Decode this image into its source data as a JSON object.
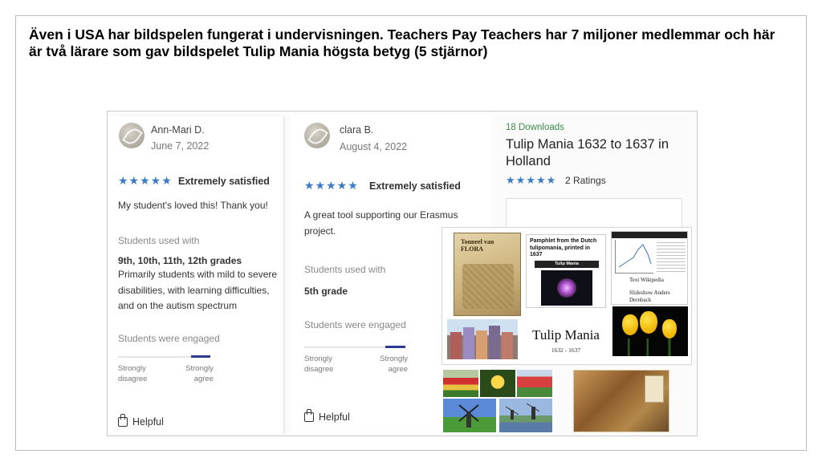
{
  "headline": "Även i USA har bildspelen fungerat i undervisningen. Teachers Pay Teachers har 7 miljoner medlemmar och här är två lärare som gav bildspelet Tulip Mania högsta betyg (5 stjärnor)",
  "colors": {
    "accent_blue": "#3a7bc8",
    "downloads_green": "#3a8a4a",
    "scale_navy": "#2b3a8f"
  },
  "reviews": [
    {
      "name": "Ann-Mari D.",
      "date": "June 7, 2022",
      "stars": "★★★★★",
      "rating_label": "Extremely satisfied",
      "text": "My student's loved this! Thank you!",
      "used_with_label": "Students used with",
      "grades": "9th, 10th, 11th, 12th grades",
      "details": "Primarily students with mild to severe disabilities, with learning difficulties, and on the autism spectrum",
      "engaged_label": "Students were engaged",
      "scale_left": "Strongly disagree",
      "scale_right": "Strongly agree",
      "engagement_level": 1.0,
      "helpful": "Helpful"
    },
    {
      "name": "clara B.",
      "date": "August 4, 2022",
      "stars": "★★★★★",
      "rating_label": "Extremely satisfied",
      "text": "A great tool supporting our Erasmus project.",
      "used_with_label": "Students used with",
      "grades": "5th grade",
      "engaged_label": "Students were engaged",
      "scale_left": "Strongly disagree",
      "scale_right": "Strongly agree",
      "engagement_level": 1.0,
      "helpful": "Helpful"
    }
  ],
  "product": {
    "downloads": "18 Downloads",
    "title": "Tulip Mania 1632 to 1637 in Holland",
    "stars": "★★★★★",
    "ratings": "2 Ratings"
  },
  "collage": {
    "book_text": "Tonneel van FLORA",
    "pamphlet_title": "Pamphlet from the Dutch tulipomania, printed in 1637",
    "pamphlet_bar": "Tulip Mania",
    "wiki_line1": "Text Wikipedia",
    "wiki_line2": "Slideshow Anders Dernback",
    "slide_title": "Tulip Mania",
    "slide_years": "1632 - 1637"
  }
}
